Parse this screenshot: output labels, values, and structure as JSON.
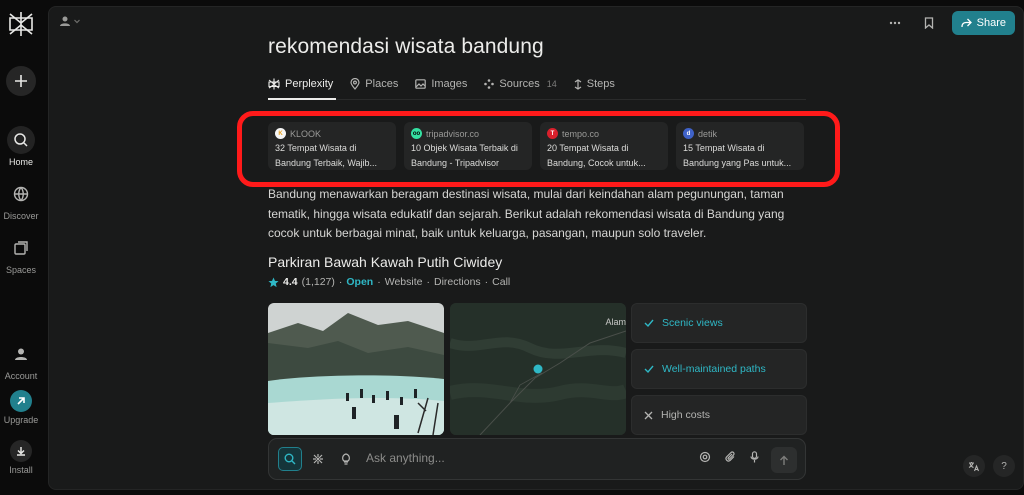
{
  "sidebar": {
    "items": [
      {
        "label": "Home"
      },
      {
        "label": "Discover"
      },
      {
        "label": "Spaces"
      },
      {
        "label": "Account"
      },
      {
        "label": "Upgrade"
      },
      {
        "label": "Install"
      }
    ]
  },
  "header": {
    "share_label": "Share"
  },
  "thread": {
    "title": "rekomendasi wisata bandung"
  },
  "tabs": [
    {
      "label": "Perplexity",
      "icon": "perplexity-icon"
    },
    {
      "label": "Places",
      "icon": "map-pin-icon"
    },
    {
      "label": "Images",
      "icon": "image-icon"
    },
    {
      "label": "Sources",
      "icon": "sources-icon",
      "count": "14"
    },
    {
      "label": "Steps",
      "icon": "steps-icon"
    }
  ],
  "sources": [
    {
      "site": "KLOOK",
      "title": "32 Tempat Wisata di Bandung Terbaik, Wajib...",
      "color": "#f5f5f5",
      "glyph": "K"
    },
    {
      "site": "tripadvisor.co",
      "title": "10 Objek Wisata Terbaik di Bandung - Tripadvisor",
      "color": "#34e0a1",
      "glyph": "oo"
    },
    {
      "site": "tempo.co",
      "title": "20 Tempat Wisata di Bandung, Cocok untuk...",
      "color": "#d9202c",
      "glyph": "T"
    },
    {
      "site": "detik",
      "title": "15 Tempat Wisata di Bandung yang Pas untuk...",
      "color": "#3f62c8",
      "glyph": "d"
    }
  ],
  "answer": {
    "paragraph": "Bandung menawarkan beragam destinasi wisata, mulai dari keindahan alam pegunungan, taman tematik, hingga wisata edukatif dan sejarah. Berikut adalah rekomendasi wisata di Bandung yang cocok untuk berbagai minat, baik untuk keluarga, pasangan, maupun solo traveler."
  },
  "place": {
    "name": "Parkiran Bawah Kawah Putih Ciwidey",
    "rating": "4.4",
    "reviews": "(1,127)",
    "open": "Open",
    "website": "Website",
    "directions": "Directions",
    "call": "Call",
    "separator": "·",
    "map_label": "Alam",
    "features": [
      {
        "label": "Scenic views",
        "kind": "positive"
      },
      {
        "label": "Well-maintained paths",
        "kind": "positive"
      },
      {
        "label": "High costs",
        "kind": "negative"
      }
    ]
  },
  "ask": {
    "placeholder": "Ask anything..."
  },
  "colors": {
    "accent": "#21808d",
    "accent_text": "#2fb8c6",
    "highlight": "#ff1a1a"
  }
}
